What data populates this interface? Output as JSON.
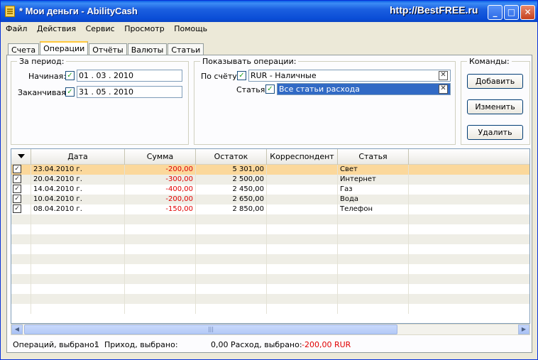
{
  "window": {
    "title": "* Мои деньги - AbilityCash",
    "watermark": "http://BestFREE.ru",
    "minimize": "_",
    "maximize": "□",
    "close": "✕"
  },
  "menu": [
    "Файл",
    "Действия",
    "Сервис",
    "Просмотр",
    "Помощь"
  ],
  "tabs": [
    {
      "label": "Счета",
      "active": false
    },
    {
      "label": "Операции",
      "active": true
    },
    {
      "label": "Отчёты",
      "active": false
    },
    {
      "label": "Валюты",
      "active": false
    },
    {
      "label": "Статьи",
      "active": false
    }
  ],
  "period": {
    "title": "За период:",
    "start_label": "Начиная:",
    "start_value": "01 . 03 . 2010",
    "end_label": "Заканчивая:",
    "end_value": "31 . 05 . 2010"
  },
  "filter": {
    "title": "Показывать операции:",
    "account_label": "По счёту:",
    "account_value": "RUR - Наличные",
    "category_label": "Статья:",
    "category_value": "Все статьи расхода"
  },
  "commands": {
    "title": "Команды:",
    "add": "Добавить",
    "edit": "Изменить",
    "delete": "Удалить"
  },
  "grid": {
    "columns": [
      "Дата",
      "Сумма",
      "Остаток",
      "Корреспондент",
      "Статья"
    ],
    "rows": [
      {
        "date": "23.04.2010 г.",
        "sum": "-200,00",
        "rest": "5 301,00",
        "corr": "",
        "cat": "Свет"
      },
      {
        "date": "20.04.2010 г.",
        "sum": "-300,00",
        "rest": "2 500,00",
        "corr": "",
        "cat": "Интернет"
      },
      {
        "date": "14.04.2010 г.",
        "sum": "-400,00",
        "rest": "2 450,00",
        "corr": "",
        "cat": "Газ"
      },
      {
        "date": "10.04.2010 г.",
        "sum": "-200,00",
        "rest": "2 650,00",
        "corr": "",
        "cat": "Вода"
      },
      {
        "date": "08.04.2010 г.",
        "sum": "-150,00",
        "rest": "2 850,00",
        "corr": "",
        "cat": "Телефон"
      }
    ],
    "selected_row": 0,
    "empty_rows": 10,
    "scroll_thumb_marker": "|||"
  },
  "status": {
    "ops_label": "Операций, выбрано:",
    "ops_value": "1",
    "income_label": "Приход, выбрано:",
    "income_value": "0,00",
    "expense_label": "Расход, выбрано:",
    "expense_value": "-200,00 RUR"
  },
  "colors": {
    "title_bar": "#1b5fe0",
    "negative": "#e00000",
    "selection": "#316ac5",
    "selected_row": "#fbd89b"
  }
}
